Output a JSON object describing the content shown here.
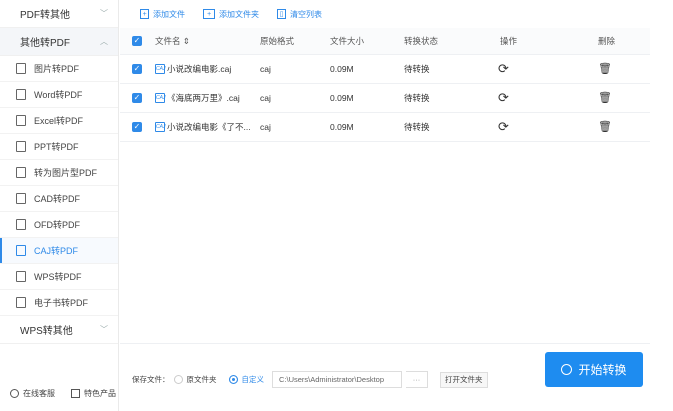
{
  "sidebar": {
    "sections": [
      "PDF转其他",
      "其他转PDF",
      "WPS转其他"
    ],
    "items": [
      {
        "label": "图片转PDF",
        "icon": "image-icon"
      },
      {
        "label": "Word转PDF",
        "icon": "word-icon"
      },
      {
        "label": "Excel转PDF",
        "icon": "excel-icon"
      },
      {
        "label": "PPT转PDF",
        "icon": "ppt-icon"
      },
      {
        "label": "转为图片型PDF",
        "icon": "image-pdf-icon"
      },
      {
        "label": "CAD转PDF",
        "icon": "cad-icon"
      },
      {
        "label": "OFD转PDF",
        "icon": "ofd-icon"
      },
      {
        "label": "CAJ转PDF",
        "icon": "caj-icon"
      },
      {
        "label": "WPS转PDF",
        "icon": "wps-icon"
      },
      {
        "label": "电子书转PDF",
        "icon": "ebook-icon"
      }
    ],
    "active": "CAJ转PDF",
    "footer": {
      "support": "在线客服",
      "products": "特色产品"
    }
  },
  "toolbar": {
    "add_file": "添加文件",
    "add_folder": "添加文件夹",
    "clear": "清空列表"
  },
  "table": {
    "headers": {
      "name": "文件名 ⇕",
      "format": "原始格式",
      "size": "文件大小",
      "status": "转换状态",
      "action": "操作",
      "delete": "删除"
    },
    "rows": [
      {
        "name": "小说改编电影.caj",
        "format": "caj",
        "size": "0.09M",
        "status": "待转换"
      },
      {
        "name": "《海底两万里》.caj",
        "format": "caj",
        "size": "0.09M",
        "status": "待转换"
      },
      {
        "name": "小说改编电影《了不...",
        "format": "caj",
        "size": "0.09M",
        "status": "待转换"
      }
    ]
  },
  "bottom": {
    "save_label": "保存文件：",
    "opt_original": "原文件夹",
    "opt_custom": "自定义",
    "path": "C:\\Users\\Administrator\\Desktop",
    "browse": "···",
    "open_folder": "打开文件夹",
    "start": "开始转换"
  },
  "colors": {
    "accent": "#1e8cf0"
  }
}
